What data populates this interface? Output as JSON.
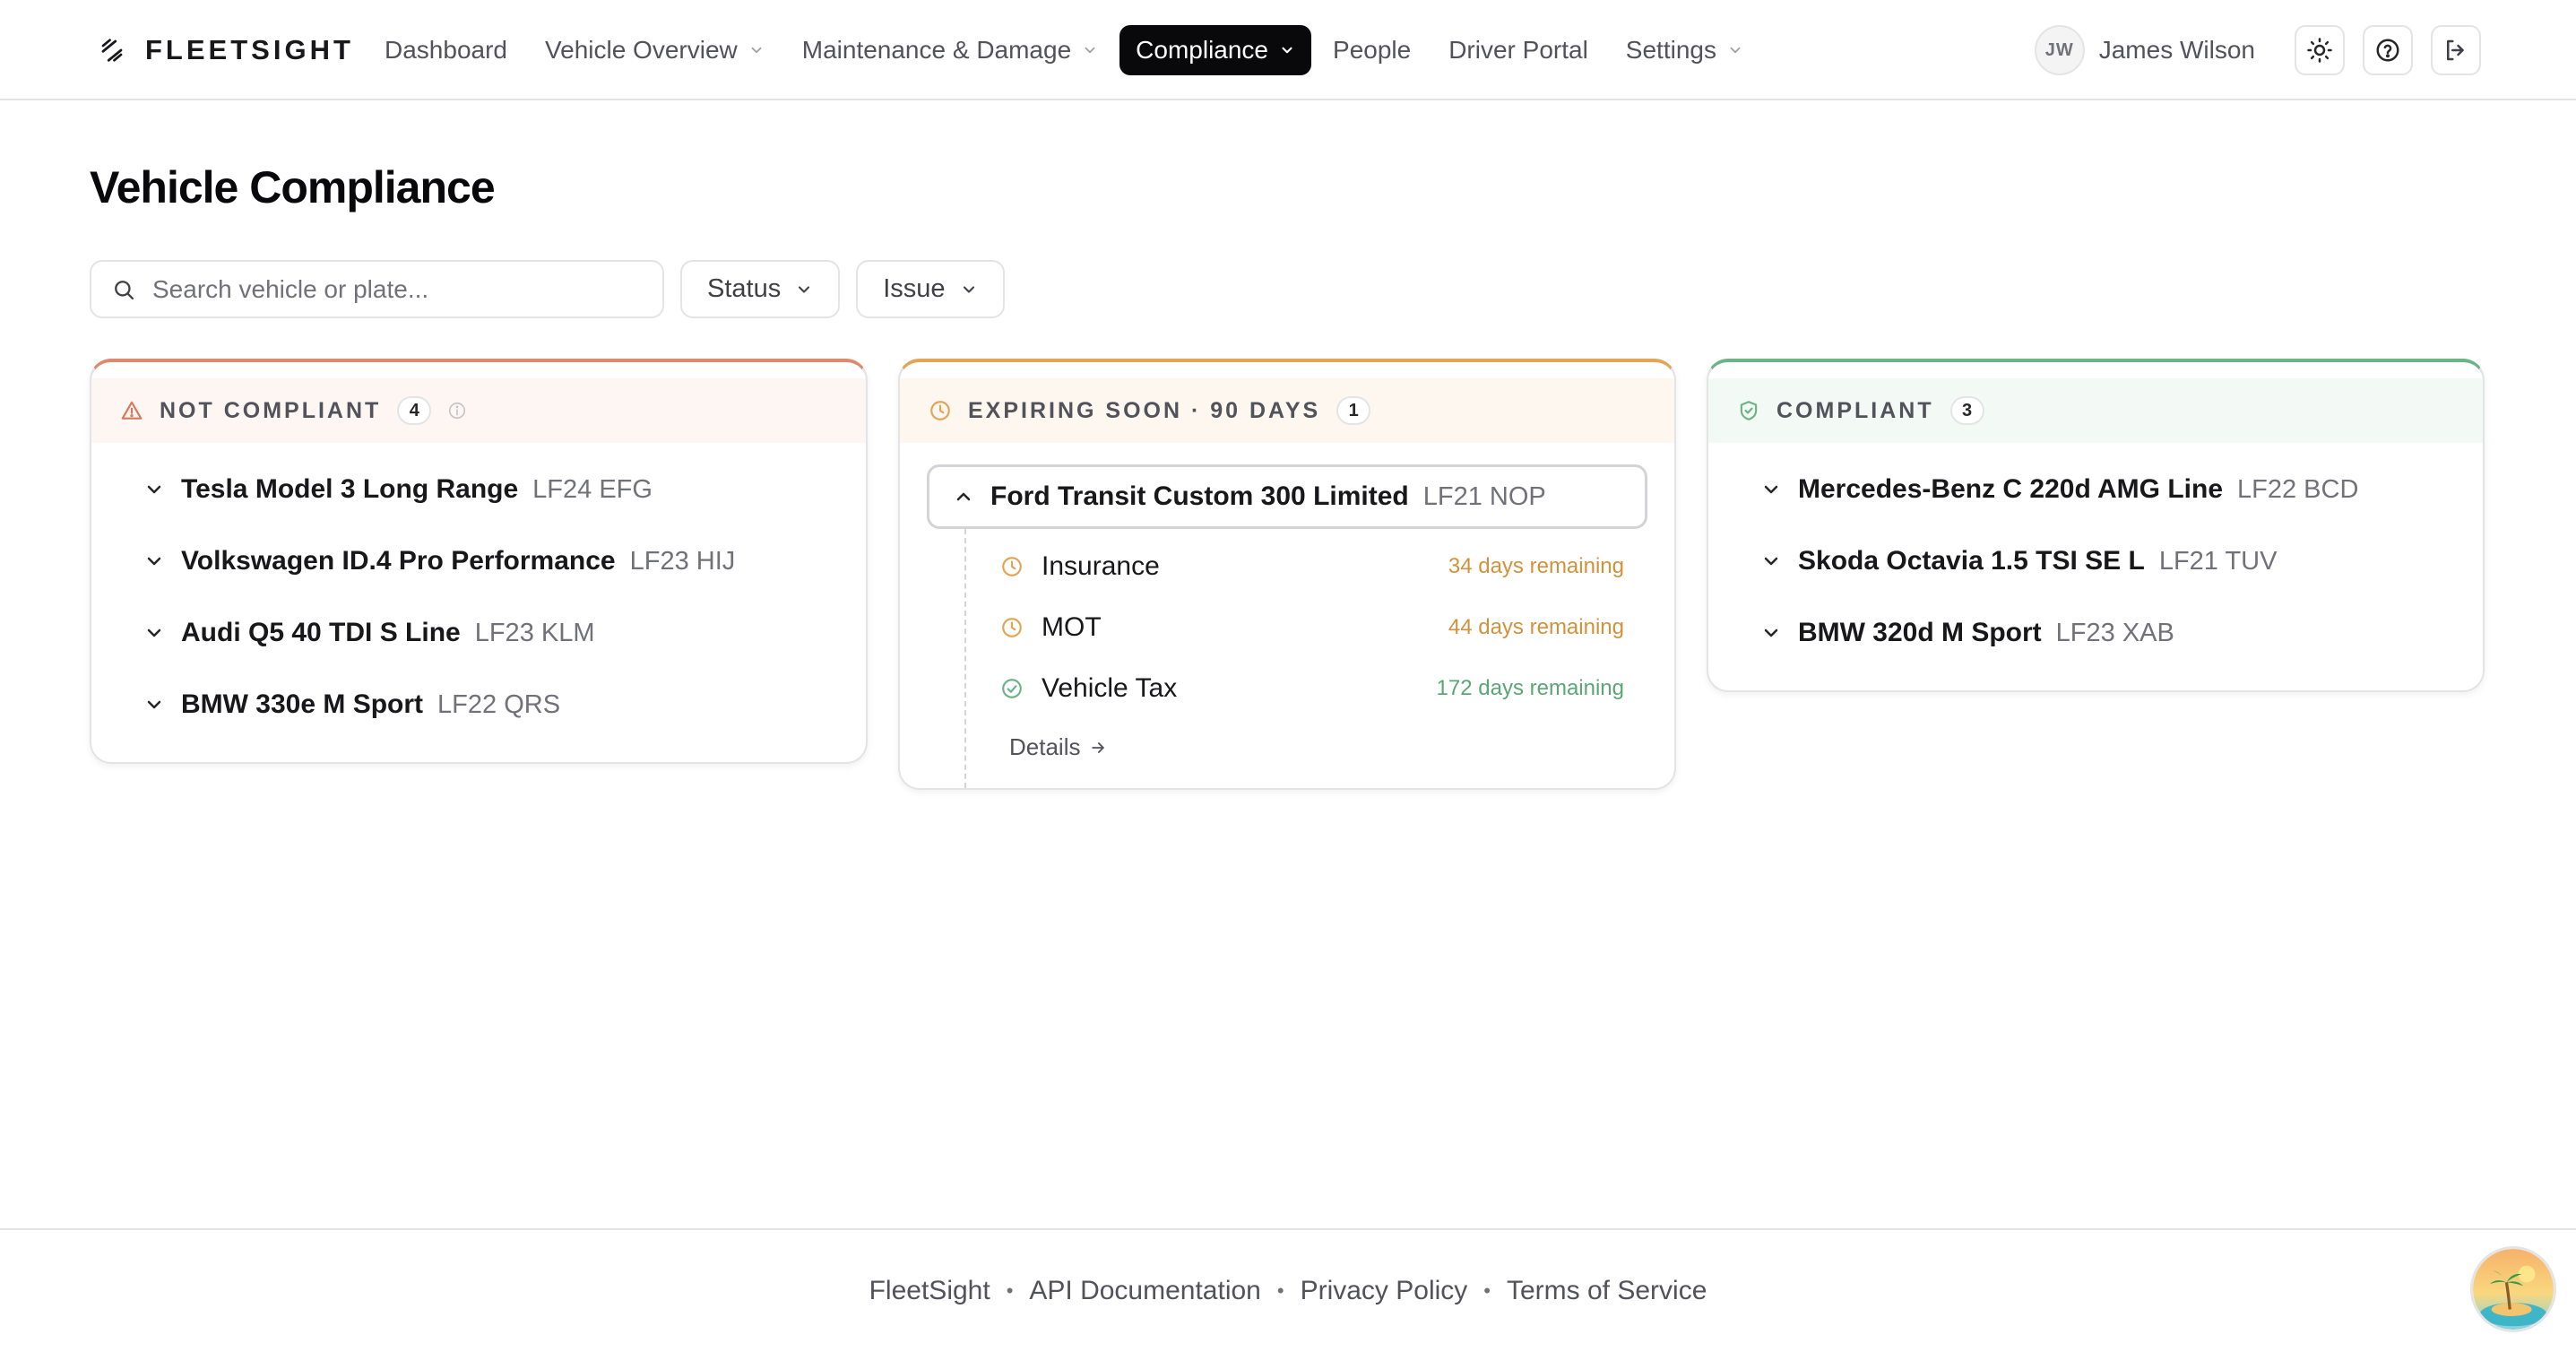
{
  "brand": {
    "name": "FLEETSIGHT"
  },
  "nav": {
    "items": [
      {
        "label": "Dashboard",
        "has_menu": false,
        "active": false
      },
      {
        "label": "Vehicle Overview",
        "has_menu": true,
        "active": false
      },
      {
        "label": "Maintenance & Damage",
        "has_menu": true,
        "active": false
      },
      {
        "label": "Compliance",
        "has_menu": true,
        "active": true
      },
      {
        "label": "People",
        "has_menu": false,
        "active": false
      },
      {
        "label": "Driver Portal",
        "has_menu": false,
        "active": false
      },
      {
        "label": "Settings",
        "has_menu": true,
        "active": false
      }
    ]
  },
  "user": {
    "initials": "JW",
    "name": "James Wilson",
    "actions": [
      "sun-icon",
      "help-icon",
      "logout-icon"
    ]
  },
  "page": {
    "title": "Vehicle Compliance"
  },
  "filters": {
    "search_placeholder": "Search vehicle or plate...",
    "search_value": "",
    "status_label": "Status",
    "issue_label": "Issue"
  },
  "columns": {
    "not_compliant": {
      "title": "NOT COMPLIANT",
      "count": "4",
      "accent": "#dc8a6e",
      "vehicles": [
        {
          "name": "Tesla Model 3 Long Range",
          "plate": "LF24 EFG"
        },
        {
          "name": "Volkswagen ID.4 Pro Performance",
          "plate": "LF23 HIJ"
        },
        {
          "name": "Audi Q5 40 TDI S Line",
          "plate": "LF23 KLM"
        },
        {
          "name": "BMW 330e M Sport",
          "plate": "LF22 QRS"
        }
      ]
    },
    "expiring_soon": {
      "title": "EXPIRING SOON · 90 DAYS",
      "count": "1",
      "accent": "#e2a555",
      "vehicles": [
        {
          "name": "Ford Transit Custom 300 Limited",
          "plate": "LF21 NOP",
          "expanded": true,
          "items": [
            {
              "label": "Insurance",
              "remaining": "34 days remaining",
              "status": "expiring"
            },
            {
              "label": "MOT",
              "remaining": "44 days remaining",
              "status": "expiring"
            },
            {
              "label": "Vehicle Tax",
              "remaining": "172 days remaining",
              "status": "ok"
            }
          ],
          "details_label": "Details"
        }
      ]
    },
    "compliant": {
      "title": "COMPLIANT",
      "count": "3",
      "accent": "#6cb386",
      "vehicles": [
        {
          "name": "Mercedes-Benz C 220d AMG Line",
          "plate": "LF22 BCD"
        },
        {
          "name": "Skoda Octavia 1.5 TSI SE L",
          "plate": "LF21 TUV"
        },
        {
          "name": "BMW 320d M Sport",
          "plate": "LF23 XAB"
        }
      ]
    }
  },
  "footer": {
    "links": [
      "FleetSight",
      "API Documentation",
      "Privacy Policy",
      "Terms of Service"
    ],
    "separator": "•"
  },
  "colors": {
    "active_nav_bg": "#09090b",
    "expiring": "#d4913b",
    "ok": "#5aa674",
    "danger": "#d9785c"
  }
}
